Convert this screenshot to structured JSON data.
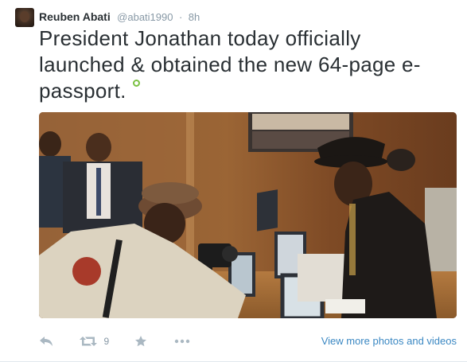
{
  "tweet": {
    "author": {
      "name": "Reuben Abati",
      "handle": "@abati1990"
    },
    "separator": "·",
    "time": "8h",
    "text": "President Jonathan today officially launched & obtained the new 64-page e-passport.",
    "retweet_count": "9",
    "view_more_label": "View more photos and videos"
  },
  "icons": {
    "location": "geo-location-icon",
    "reply": "reply-icon",
    "retweet": "retweet-icon",
    "favorite": "star-icon",
    "more": "more-dots-icon"
  },
  "colors": {
    "name": "#292f33",
    "meta": "#8899a6",
    "link": "#3b88c3",
    "action_icon": "#aab8c2",
    "geo": "#7ac142"
  }
}
